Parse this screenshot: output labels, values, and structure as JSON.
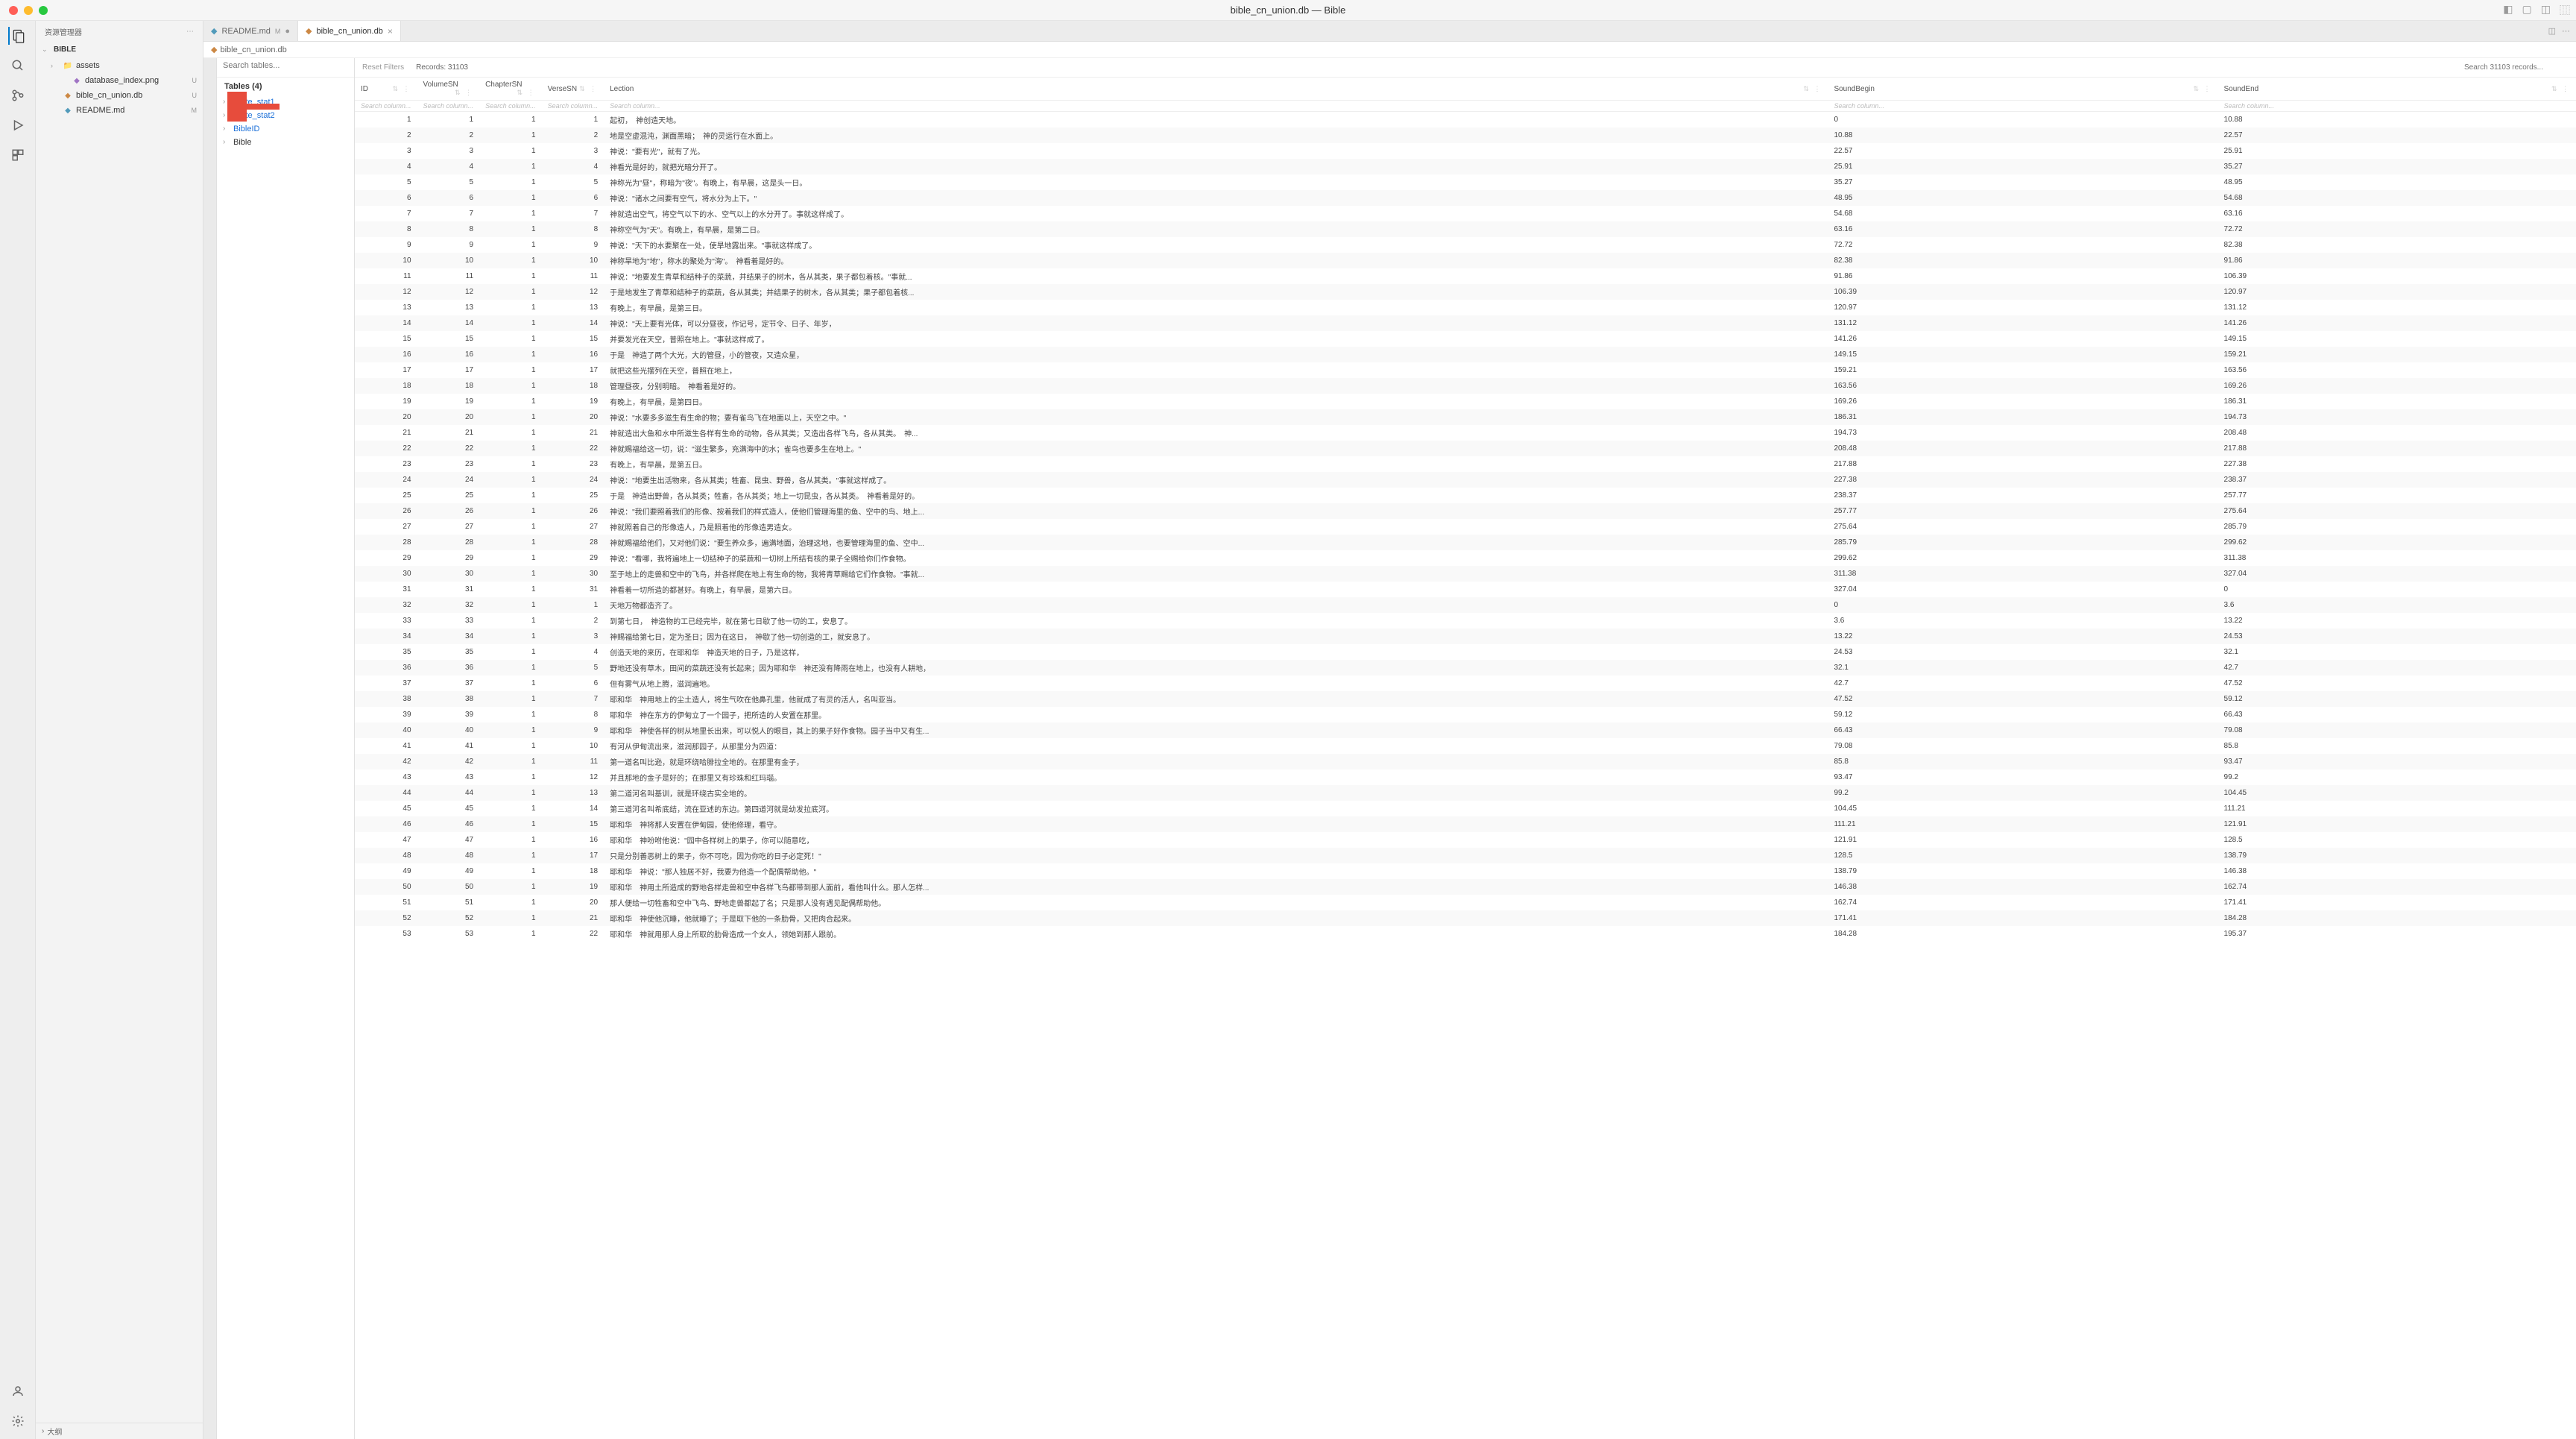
{
  "window_title": "bible_cn_union.db — Bible",
  "sidebar_title": "资源管理器",
  "project_name": "BIBLE",
  "sidebar_files": [
    {
      "name": "assets",
      "icon": "folder",
      "status": "",
      "type": "folder"
    },
    {
      "name": "database_index.png",
      "icon": "img",
      "status": "U",
      "type": "file",
      "indent": true
    },
    {
      "name": "bible_cn_union.db",
      "icon": "db",
      "status": "U",
      "type": "file"
    },
    {
      "name": "README.md",
      "icon": "md",
      "status": "M",
      "type": "file"
    }
  ],
  "outline_label": "大纲",
  "tabs": [
    {
      "label": "README.md",
      "status": "M",
      "active": false
    },
    {
      "label": "bible_cn_union.db",
      "status": "",
      "active": true
    }
  ],
  "breadcrumb": {
    "file": "bible_cn_union.db"
  },
  "tables_search_placeholder": "Search tables...",
  "tables_header": "Tables (4)",
  "tables": [
    {
      "name": "sqlite_stat1"
    },
    {
      "name": "sqlite_stat2"
    },
    {
      "name": "BibleID"
    },
    {
      "name": "Bible",
      "selected": true
    }
  ],
  "reset_filters_label": "Reset Filters",
  "records_label": "Records: 31103",
  "search_records_placeholder": "Search 31103 records...",
  "columns": [
    "ID",
    "VolumeSN",
    "ChapterSN",
    "VerseSN",
    "Lection",
    "SoundBegin",
    "SoundEnd"
  ],
  "filter_placeholder": "Search column...",
  "rows": [
    {
      "id": 1,
      "vol": 1,
      "chap": 1,
      "verse": 1,
      "lection": "起初，　神创造天地。",
      "sb": "0",
      "se": "10.88"
    },
    {
      "id": 2,
      "vol": 2,
      "chap": 1,
      "verse": 2,
      "lection": "地是空虚混沌，渊面黑暗；　神的灵运行在水面上。",
      "sb": "10.88",
      "se": "22.57"
    },
    {
      "id": 3,
      "vol": 3,
      "chap": 1,
      "verse": 3,
      "lection": "神说：\"要有光\"，就有了光。",
      "sb": "22.57",
      "se": "25.91"
    },
    {
      "id": 4,
      "vol": 4,
      "chap": 1,
      "verse": 4,
      "lection": "神看光是好的，就把光暗分开了。",
      "sb": "25.91",
      "se": "35.27"
    },
    {
      "id": 5,
      "vol": 5,
      "chap": 1,
      "verse": 5,
      "lection": "神称光为\"昼\"，称暗为\"夜\"。有晚上，有早晨，这是头一日。",
      "sb": "35.27",
      "se": "48.95"
    },
    {
      "id": 6,
      "vol": 6,
      "chap": 1,
      "verse": 6,
      "lection": "神说：\"诸水之间要有空气，将水分为上下。\"",
      "sb": "48.95",
      "se": "54.68"
    },
    {
      "id": 7,
      "vol": 7,
      "chap": 1,
      "verse": 7,
      "lection": "神就造出空气，将空气以下的水、空气以上的水分开了。事就这样成了。",
      "sb": "54.68",
      "se": "63.16"
    },
    {
      "id": 8,
      "vol": 8,
      "chap": 1,
      "verse": 8,
      "lection": "神称空气为\"天\"。有晚上，有早晨，是第二日。",
      "sb": "63.16",
      "se": "72.72"
    },
    {
      "id": 9,
      "vol": 9,
      "chap": 1,
      "verse": 9,
      "lection": "神说：\"天下的水要聚在一处，使旱地露出来。\"事就这样成了。",
      "sb": "72.72",
      "se": "82.38"
    },
    {
      "id": 10,
      "vol": 10,
      "chap": 1,
      "verse": 10,
      "lection": "神称旱地为\"地\"，称水的聚处为\"海\"。　神看着是好的。",
      "sb": "82.38",
      "se": "91.86"
    },
    {
      "id": 11,
      "vol": 11,
      "chap": 1,
      "verse": 11,
      "lection": "神说：\"地要发生青草和结种子的菜蔬，并结果子的树木，各从其类，果子都包着核。\"事就...",
      "sb": "91.86",
      "se": "106.39"
    },
    {
      "id": 12,
      "vol": 12,
      "chap": 1,
      "verse": 12,
      "lection": "于是地发生了青草和结种子的菜蔬，各从其类；并结果子的树木，各从其类；果子都包着核...",
      "sb": "106.39",
      "se": "120.97"
    },
    {
      "id": 13,
      "vol": 13,
      "chap": 1,
      "verse": 13,
      "lection": "有晚上，有早晨，是第三日。",
      "sb": "120.97",
      "se": "131.12"
    },
    {
      "id": 14,
      "vol": 14,
      "chap": 1,
      "verse": 14,
      "lection": "神说：\"天上要有光体，可以分昼夜，作记号，定节令、日子、年岁，",
      "sb": "131.12",
      "se": "141.26"
    },
    {
      "id": 15,
      "vol": 15,
      "chap": 1,
      "verse": 15,
      "lection": "并要发光在天空，普照在地上。\"事就这样成了。",
      "sb": "141.26",
      "se": "149.15"
    },
    {
      "id": 16,
      "vol": 16,
      "chap": 1,
      "verse": 16,
      "lection": "于是　神造了两个大光，大的管昼，小的管夜，又造众星，",
      "sb": "149.15",
      "se": "159.21"
    },
    {
      "id": 17,
      "vol": 17,
      "chap": 1,
      "verse": 17,
      "lection": "就把这些光摆列在天空，普照在地上，",
      "sb": "159.21",
      "se": "163.56"
    },
    {
      "id": 18,
      "vol": 18,
      "chap": 1,
      "verse": 18,
      "lection": "管理昼夜，分别明暗。　神看着是好的。",
      "sb": "163.56",
      "se": "169.26"
    },
    {
      "id": 19,
      "vol": 19,
      "chap": 1,
      "verse": 19,
      "lection": "有晚上，有早晨，是第四日。",
      "sb": "169.26",
      "se": "186.31"
    },
    {
      "id": 20,
      "vol": 20,
      "chap": 1,
      "verse": 20,
      "lection": "神说：\"水要多多滋生有生命的物；要有雀鸟飞在地面以上，天空之中。\"",
      "sb": "186.31",
      "se": "194.73"
    },
    {
      "id": 21,
      "vol": 21,
      "chap": 1,
      "verse": 21,
      "lection": "神就造出大鱼和水中所滋生各样有生命的动物，各从其类；又造出各样飞鸟，各从其类。　神...",
      "sb": "194.73",
      "se": "208.48"
    },
    {
      "id": 22,
      "vol": 22,
      "chap": 1,
      "verse": 22,
      "lection": "神就赐福给这一切，说：\"滋生繁多，充满海中的水；雀鸟也要多生在地上。\"",
      "sb": "208.48",
      "se": "217.88"
    },
    {
      "id": 23,
      "vol": 23,
      "chap": 1,
      "verse": 23,
      "lection": "有晚上，有早晨，是第五日。",
      "sb": "217.88",
      "se": "227.38"
    },
    {
      "id": 24,
      "vol": 24,
      "chap": 1,
      "verse": 24,
      "lection": "神说：\"地要生出活物来，各从其类；牲畜、昆虫、野兽，各从其类。\"事就这样成了。",
      "sb": "227.38",
      "se": "238.37"
    },
    {
      "id": 25,
      "vol": 25,
      "chap": 1,
      "verse": 25,
      "lection": "于是　神造出野兽，各从其类；牲畜，各从其类；地上一切昆虫，各从其类。　神看着是好的。",
      "sb": "238.37",
      "se": "257.77"
    },
    {
      "id": 26,
      "vol": 26,
      "chap": 1,
      "verse": 26,
      "lection": "神说：\"我们要照着我们的形像、按着我们的样式造人，使他们管理海里的鱼、空中的鸟、地上...",
      "sb": "257.77",
      "se": "275.64"
    },
    {
      "id": 27,
      "vol": 27,
      "chap": 1,
      "verse": 27,
      "lection": "神就照着自己的形像造人，乃是照着他的形像造男造女。",
      "sb": "275.64",
      "se": "285.79"
    },
    {
      "id": 28,
      "vol": 28,
      "chap": 1,
      "verse": 28,
      "lection": "神就赐福给他们，又对他们说：\"要生养众多，遍满地面，治理这地，也要管理海里的鱼、空中...",
      "sb": "285.79",
      "se": "299.62"
    },
    {
      "id": 29,
      "vol": 29,
      "chap": 1,
      "verse": 29,
      "lection": "神说：\"看哪，我将遍地上一切结种子的菜蔬和一切树上所结有核的果子全赐给你们作食物。",
      "sb": "299.62",
      "se": "311.38"
    },
    {
      "id": 30,
      "vol": 30,
      "chap": 1,
      "verse": 30,
      "lection": "至于地上的走兽和空中的飞鸟，并各样爬在地上有生命的物，我将青草赐给它们作食物。\"事就...",
      "sb": "311.38",
      "se": "327.04"
    },
    {
      "id": 31,
      "vol": 31,
      "chap": 1,
      "verse": 31,
      "lection": "神看着一切所造的都甚好。有晚上，有早晨，是第六日。",
      "sb": "327.04",
      "se": "0"
    },
    {
      "id": 32,
      "vol": 32,
      "chap": 2,
      "verse": 1,
      "lection": "天地万物都造齐了。",
      "sb": "0",
      "se": "3.6"
    },
    {
      "id": 33,
      "vol": 33,
      "chap": 2,
      "verse": 2,
      "lection": "到第七日，　神造物的工已经完毕，就在第七日歇了他一切的工，安息了。",
      "sb": "3.6",
      "se": "13.22"
    },
    {
      "id": 34,
      "vol": 34,
      "chap": 2,
      "verse": 3,
      "lection": "神赐福给第七日，定为圣日；因为在这日，　神歇了他一切创造的工，就安息了。",
      "sb": "13.22",
      "se": "24.53"
    },
    {
      "id": 35,
      "vol": 35,
      "chap": 2,
      "verse": 4,
      "lection": "创造天地的来历，在耶和华　神造天地的日子，乃是这样，",
      "sb": "24.53",
      "se": "32.1"
    },
    {
      "id": 36,
      "vol": 36,
      "chap": 2,
      "verse": 5,
      "lection": "野地还没有草木，田间的菜蔬还没有长起来；因为耶和华　神还没有降雨在地上，也没有人耕地，",
      "sb": "32.1",
      "se": "42.7"
    },
    {
      "id": 37,
      "vol": 37,
      "chap": 2,
      "verse": 6,
      "lection": "但有雾气从地上腾，滋润遍地。",
      "sb": "42.7",
      "se": "47.52"
    },
    {
      "id": 38,
      "vol": 38,
      "chap": 2,
      "verse": 7,
      "lection": "耶和华　神用地上的尘土造人，将生气吹在他鼻孔里，他就成了有灵的活人，名叫亚当。",
      "sb": "47.52",
      "se": "59.12"
    },
    {
      "id": 39,
      "vol": 39,
      "chap": 2,
      "verse": 8,
      "lection": "耶和华　神在东方的伊甸立了一个园子，把所造的人安置在那里。",
      "sb": "59.12",
      "se": "66.43"
    },
    {
      "id": 40,
      "vol": 40,
      "chap": 2,
      "verse": 9,
      "lection": "耶和华　神使各样的树从地里长出来，可以悦人的眼目，其上的果子好作食物。园子当中又有生...",
      "sb": "66.43",
      "se": "79.08"
    },
    {
      "id": 41,
      "vol": 41,
      "chap": 2,
      "verse": 10,
      "lection": "有河从伊甸流出来，滋润那园子，从那里分为四道：",
      "sb": "79.08",
      "se": "85.8"
    },
    {
      "id": 42,
      "vol": 42,
      "chap": 2,
      "verse": 11,
      "lection": "第一道名叫比逊，就是环绕哈腓拉全地的。在那里有金子，",
      "sb": "85.8",
      "se": "93.47"
    },
    {
      "id": 43,
      "vol": 43,
      "chap": 2,
      "verse": 12,
      "lection": "并且那地的金子是好的；在那里又有珍珠和红玛瑙。",
      "sb": "93.47",
      "se": "99.2"
    },
    {
      "id": 44,
      "vol": 44,
      "chap": 2,
      "verse": 13,
      "lection": "第二道河名叫基训，就是环绕古实全地的。",
      "sb": "99.2",
      "se": "104.45"
    },
    {
      "id": 45,
      "vol": 45,
      "chap": 2,
      "verse": 14,
      "lection": "第三道河名叫希底结，流在亚述的东边。第四道河就是幼发拉底河。",
      "sb": "104.45",
      "se": "111.21"
    },
    {
      "id": 46,
      "vol": 46,
      "chap": 2,
      "verse": 15,
      "lection": "耶和华　神将那人安置在伊甸园，使他修理，看守。",
      "sb": "111.21",
      "se": "121.91"
    },
    {
      "id": 47,
      "vol": 47,
      "chap": 2,
      "verse": 16,
      "lection": "耶和华　神吩咐他说：\"园中各样树上的果子，你可以随意吃，",
      "sb": "121.91",
      "se": "128.5"
    },
    {
      "id": 48,
      "vol": 48,
      "chap": 2,
      "verse": 17,
      "lection": "只是分别善恶树上的果子，你不可吃，因为你吃的日子必定死！\"",
      "sb": "128.5",
      "se": "138.79"
    },
    {
      "id": 49,
      "vol": 49,
      "chap": 2,
      "verse": 18,
      "lection": "耶和华　神说：\"那人独居不好，我要为他造一个配偶帮助他。\"",
      "sb": "138.79",
      "se": "146.38"
    },
    {
      "id": 50,
      "vol": 50,
      "chap": 2,
      "verse": 19,
      "lection": "耶和华　神用土所造成的野地各样走兽和空中各样飞鸟都带到那人面前，看他叫什么。那人怎样...",
      "sb": "146.38",
      "se": "162.74"
    },
    {
      "id": 51,
      "vol": 51,
      "chap": 2,
      "verse": 20,
      "lection": "那人便给一切牲畜和空中飞鸟、野地走兽都起了名；只是那人没有遇见配偶帮助他。",
      "sb": "162.74",
      "se": "171.41"
    },
    {
      "id": 52,
      "vol": 52,
      "chap": 2,
      "verse": 21,
      "lection": "耶和华　神使他沉睡，他就睡了；于是取下他的一条肋骨，又把肉合起来。",
      "sb": "171.41",
      "se": "184.28"
    },
    {
      "id": 53,
      "vol": 53,
      "chap": 2,
      "verse": 22,
      "lection": "耶和华　神就用那人身上所取的肋骨造成一个女人，领她到那人跟前。",
      "sb": "184.28",
      "se": "195.37"
    }
  ]
}
